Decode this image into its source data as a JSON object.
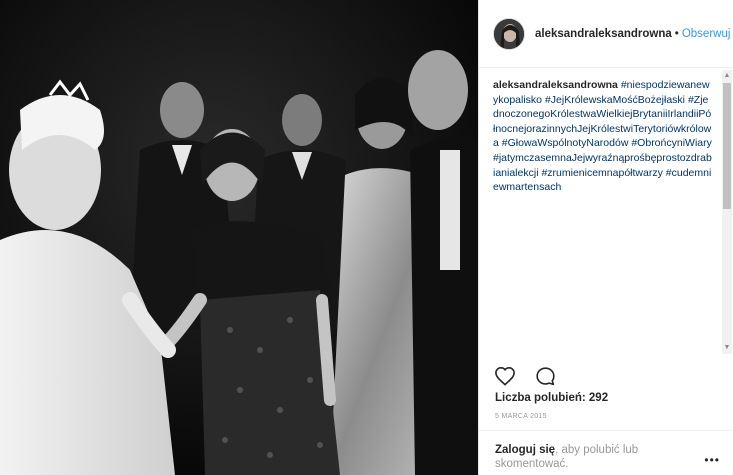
{
  "header": {
    "username": "aleksandraleksandrowna",
    "separator": "•",
    "follow_label": "Obserwuj"
  },
  "caption": {
    "username": "aleksandraleksandrowna",
    "tags": [
      "#niespodziewanewykopalisko",
      "#JejKrólewskaMośćBożejłaski",
      "#ZjednoczonegoKrólestwaWielkiejBrytaniiIrlandiiPółnocnejorazinnychJejKrólestwiTerytoriówkrólowa",
      "#GłowaWspólnotyNarodów",
      "#ObrońcyniWiary",
      "#jatymczasemnaJejwyraźnąprośbęprostozdrabianialekcji",
      "#zrumienicemnapółtwarzy",
      "#cudemniewmartensach"
    ]
  },
  "icons": {
    "like": "heart-icon",
    "comment": "comment-icon",
    "more": "more-options-icon"
  },
  "likes_text": "Liczba polubień: 292",
  "date": "5 MARCA 2015",
  "login": {
    "link": "Zaloguj się",
    "rest": ", aby polubić lub skomentować."
  },
  "more_label": "•••",
  "colors": {
    "link": "#3897f0",
    "hashtag": "#003569",
    "muted": "#999999",
    "text": "#262626"
  }
}
